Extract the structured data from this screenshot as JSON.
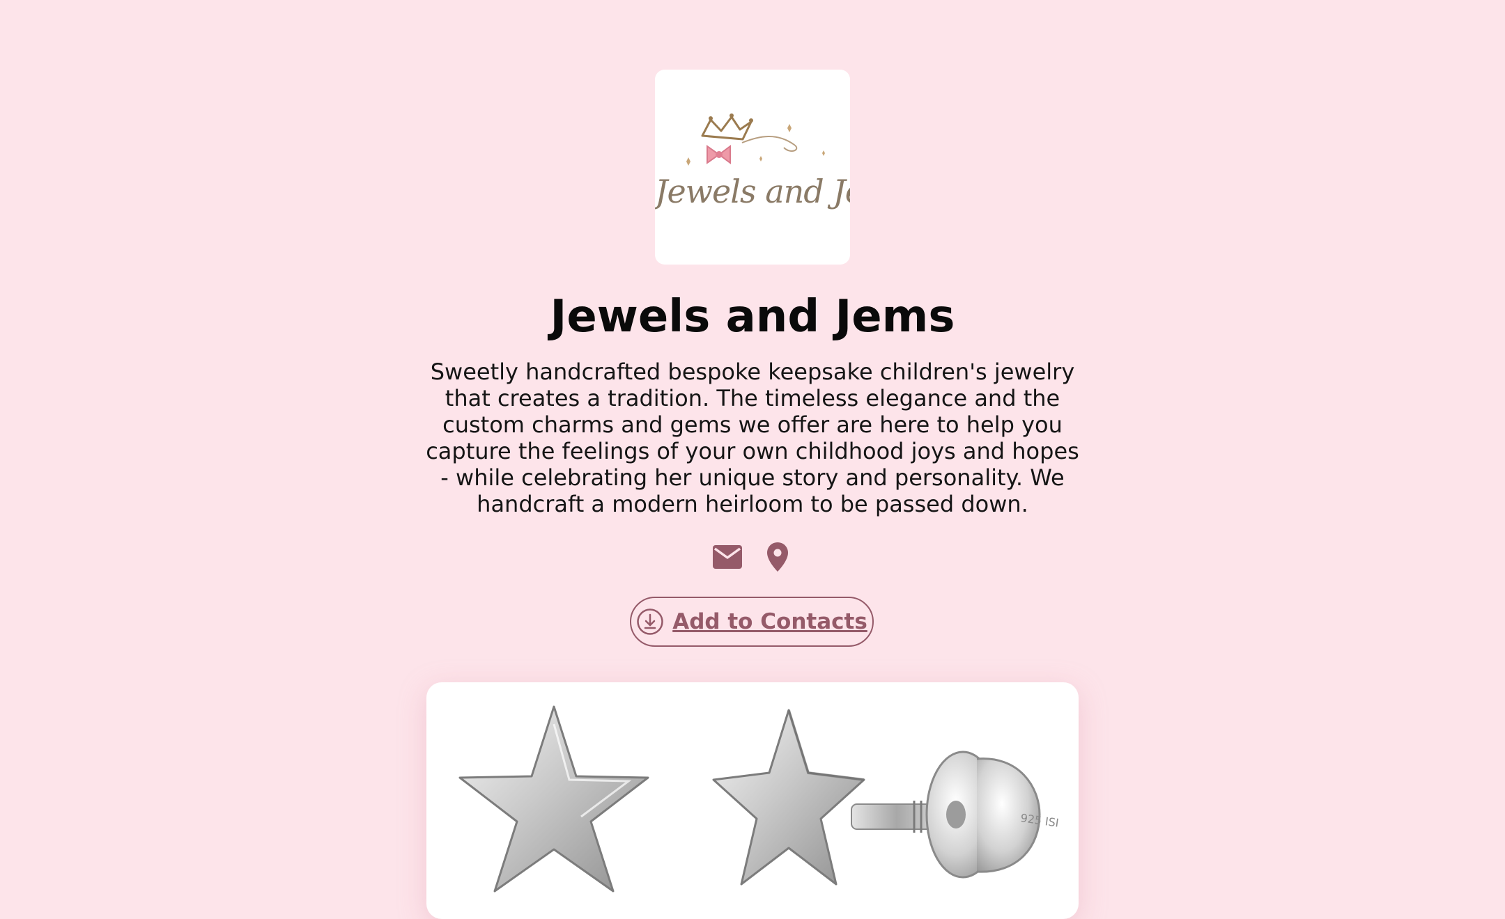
{
  "profile": {
    "logo_text": "Jewels and Jems",
    "title": "Jewels and Jems",
    "description": "Sweetly handcrafted bespoke keepsake children's jewelry that creates a tradition. The timeless elegance and the custom charms and gems we offer are here to help you capture the feelings of your own childhood joys and hopes - while celebrating her unique story and personality. We handcraft a modern heirloom to be passed down."
  },
  "contact_icons": [
    {
      "icon": "mail-icon"
    },
    {
      "icon": "location-pin-icon"
    }
  ],
  "actions": {
    "add_to_contacts_label": "Add to Contacts",
    "add_to_contacts_icon": "download-circle-icon"
  },
  "product": {
    "image_subject": "silver star stud earrings",
    "stamp_text": "925 ISI"
  },
  "colors": {
    "background": "#fde4ea",
    "accent": "#955a69",
    "title": "#0a0a0a",
    "card": "#ffffff"
  }
}
